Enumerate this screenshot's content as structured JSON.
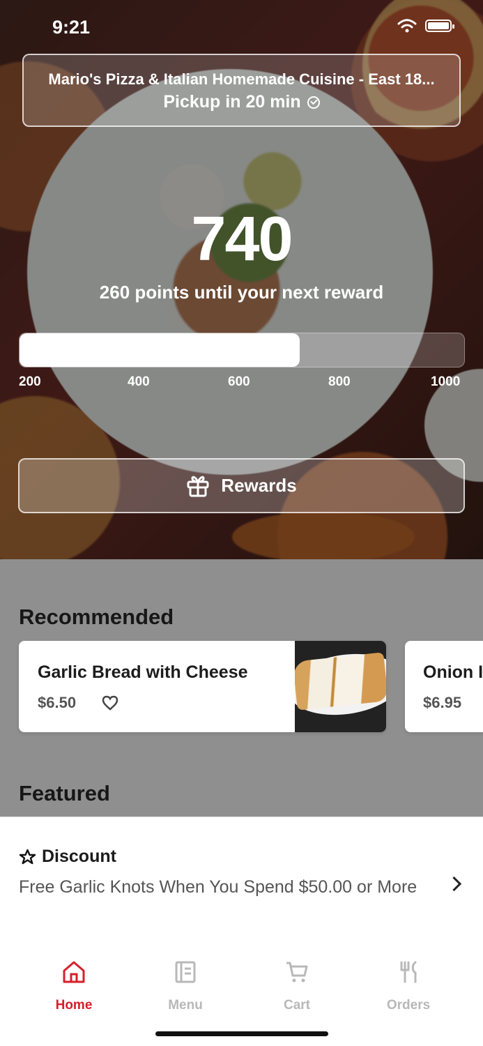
{
  "status": {
    "time": "9:21"
  },
  "store": {
    "name": "Mario's Pizza & Italian Homemade Cuisine - East 18...",
    "pickup": "Pickup in 20 min"
  },
  "rewards": {
    "points": "740",
    "next_reward": "260 points until your next reward",
    "progress_fraction": 0.63,
    "ticks": [
      "200",
      "400",
      "600",
      "800",
      "1000"
    ],
    "button_label": "Rewards"
  },
  "recommended": {
    "title": "Recommended",
    "items": [
      {
        "name": "Garlic Bread with Cheese",
        "price": "$6.50"
      },
      {
        "name": "Onion I",
        "price": "$6.95"
      }
    ]
  },
  "featured": {
    "title": "Featured",
    "discount_title": "Discount",
    "discount_text": "Free Garlic Knots When You Spend $50.00 or More"
  },
  "tabs": [
    {
      "label": "Home",
      "icon": "home-icon",
      "active": true
    },
    {
      "label": "Menu",
      "icon": "menu-icon",
      "active": false
    },
    {
      "label": "Cart",
      "icon": "cart-icon",
      "active": false
    },
    {
      "label": "Orders",
      "icon": "orders-icon",
      "active": false
    }
  ],
  "colors": {
    "accent": "#d71f2b",
    "inactive": "#b8b8b8"
  }
}
